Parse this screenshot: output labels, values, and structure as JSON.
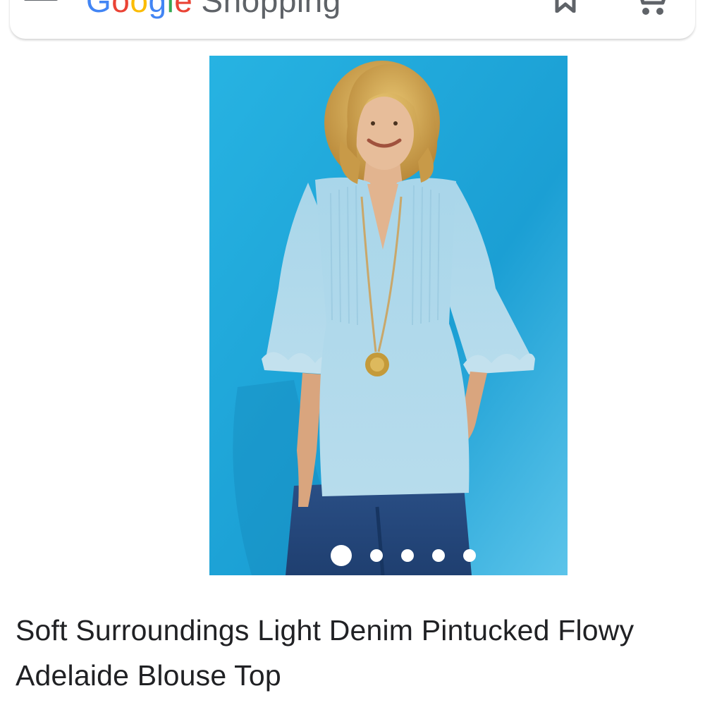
{
  "header": {
    "logo": {
      "g1": "G",
      "g2": "o",
      "g3": "o",
      "g4": "g",
      "g5": "l",
      "g6": "e",
      "shopping": "Shopping"
    },
    "icons": {
      "menu": "menu-icon",
      "bookmark": "bookmark-icon",
      "cart": "cart-icon"
    }
  },
  "product": {
    "title": "Soft Surroundings Light Denim Pintucked Flowy Adelaide Blouse Top",
    "image": {
      "description_icon": "product-photo",
      "background_color": "#1fa9d9"
    },
    "carousel": {
      "count": 5,
      "active_index": 0
    }
  },
  "colors": {
    "brand_blue": "#4285f4",
    "brand_red": "#ea4335",
    "brand_yellow": "#fbbc05",
    "brand_green": "#34a853",
    "text": "#202124",
    "icon_gray": "#5f6368"
  }
}
